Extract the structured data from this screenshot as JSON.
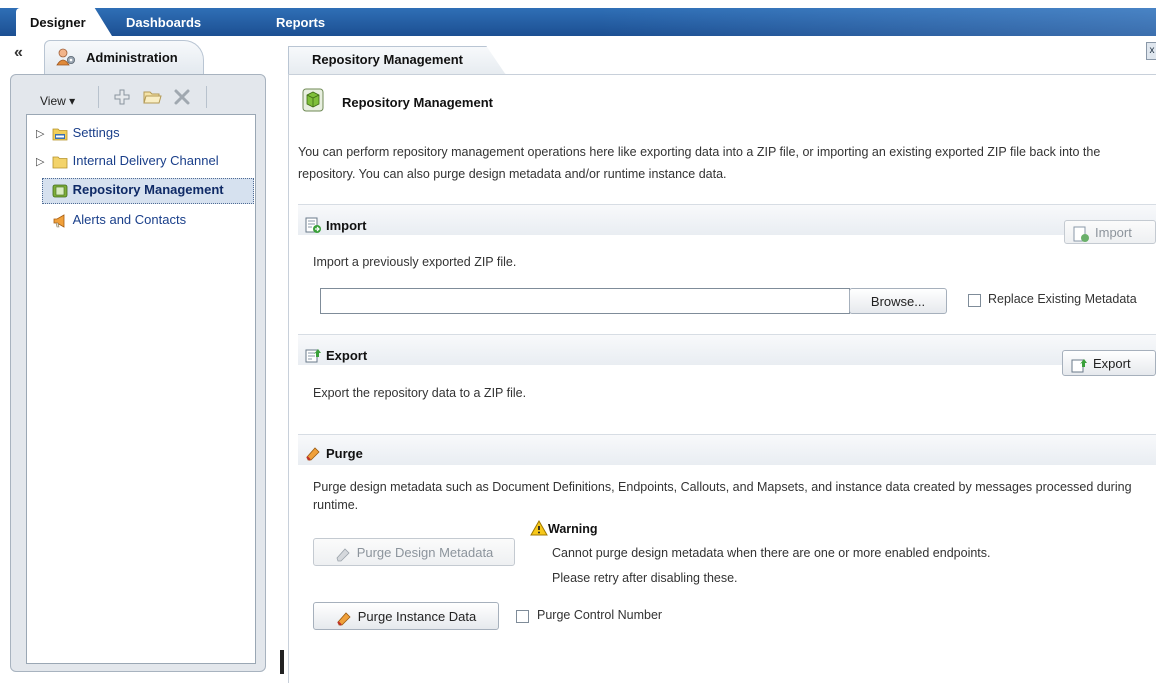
{
  "top_tabs": [
    {
      "label": "Designer",
      "active": true
    },
    {
      "label": "Dashboards",
      "active": false
    },
    {
      "label": "Reports",
      "active": false
    }
  ],
  "left_panel": {
    "collapse_label": "«",
    "header_title": "Administration",
    "toolbar": {
      "view_label": "View ▾"
    },
    "tree": [
      {
        "label": "Settings",
        "icon": "settings-folder-icon",
        "expandable": true
      },
      {
        "label": "Internal Delivery Channel",
        "icon": "folder-icon",
        "expandable": true
      },
      {
        "label": "Repository Management",
        "icon": "repository-icon",
        "selected": true
      },
      {
        "label": "Alerts and Contacts",
        "icon": "megaphone-icon"
      }
    ]
  },
  "right_panel": {
    "tab_title": "Repository Management",
    "close_label": "x",
    "page_title": "Repository Management",
    "intro_text": "You can perform repository management operations here like exporting data into a ZIP file, or importing an existing exported ZIP file back into the repository.  You can also purge design metadata and/or runtime instance data.",
    "import": {
      "title": "Import",
      "button_label": "Import",
      "description": "Import a previously exported ZIP file.",
      "file_value": "",
      "browse_label": "Browse...",
      "replace_label": "Replace Existing Metadata",
      "replace_checked": false
    },
    "export": {
      "title": "Export",
      "button_label": "Export",
      "description": "Export the repository data to a ZIP file."
    },
    "purge": {
      "title": "Purge",
      "description": "Purge design metadata such as Document Definitions, Endpoints, Callouts, and Mapsets, and instance data created by messages processed during runtime.",
      "warning_title": "Warning",
      "warning_line1": "Cannot purge design metadata when there are one or more enabled endpoints.",
      "warning_line2": "Please retry after disabling these.",
      "design_button_label": "Purge Design Metadata",
      "instance_button_label": "Purge Instance Data",
      "control_number_label": "Purge Control Number",
      "control_number_checked": false
    }
  },
  "colors": {
    "tab_bar": "#1c4f92",
    "tree_link": "#1a3f8a",
    "selection": "#d6e1ef"
  }
}
